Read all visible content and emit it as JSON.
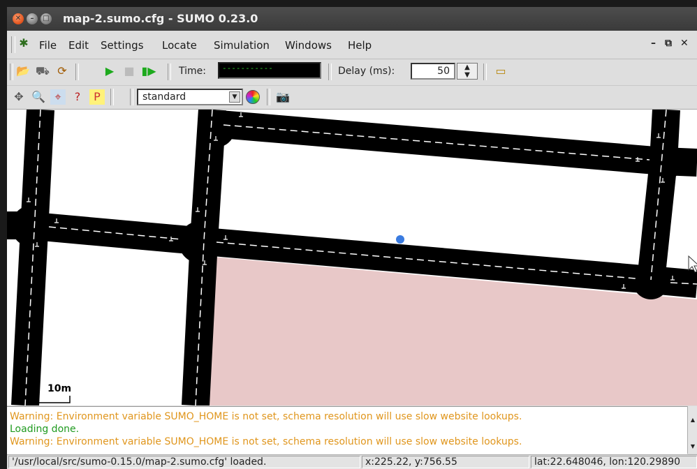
{
  "window": {
    "title": "map-2.sumo.cfg - SUMO 0.23.0"
  },
  "menu": {
    "items": [
      {
        "label": "File"
      },
      {
        "label": "Edit"
      },
      {
        "label": "Settings"
      },
      {
        "label": "Locate"
      },
      {
        "label": "Simulation"
      },
      {
        "label": "Windows"
      },
      {
        "label": "Help"
      }
    ]
  },
  "toolbar": {
    "time_label": "Time:",
    "time_value": "-----------",
    "delay_label": "Delay (ms):",
    "delay_value": "50",
    "scheme_value": "standard"
  },
  "map": {
    "scale_label": "10m"
  },
  "messages": [
    {
      "text": "Warning: Environment variable SUMO_HOME is not set, schema resolution will use slow website lookups.",
      "kind": "warning"
    },
    {
      "text": "Loading done.",
      "kind": "info"
    },
    {
      "text": "Warning: Environment variable SUMO_HOME is not set, schema resolution will use slow website lookups.",
      "kind": "warning"
    }
  ],
  "status": {
    "file_loaded": "'/usr/local/src/sumo-0.15.0/map-2.sumo.cfg' loaded.",
    "coords": "x:225.22, y:756.55",
    "geo": "lat:22.648046, lon:120.29890"
  },
  "colors": {
    "road": "#000000",
    "lane_marking": "#ffffff",
    "area_fill": "#e8c8c8",
    "vehicle_dot": "#3a7be0",
    "warning_text": "#e0961d",
    "info_text": "#1f9a1f"
  }
}
